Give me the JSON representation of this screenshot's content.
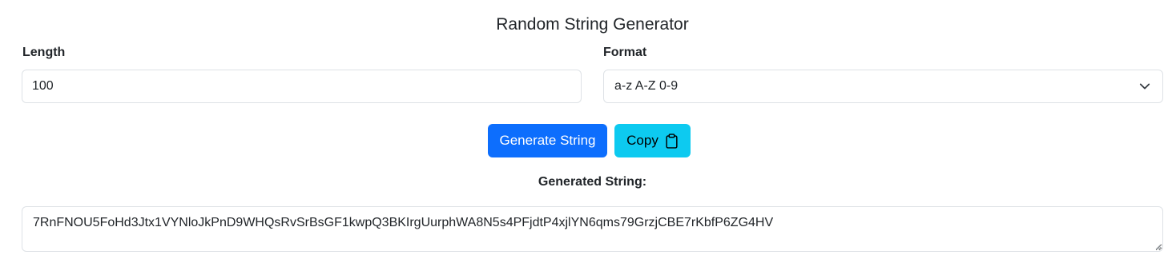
{
  "header": {
    "title": "Random String Generator"
  },
  "length_field": {
    "label": "Length",
    "value": "100"
  },
  "format_field": {
    "label": "Format",
    "selected": "a-z A-Z 0-9",
    "icon": "chevron-down-icon"
  },
  "actions": {
    "generate_label": "Generate String",
    "copy_label": "Copy",
    "copy_icon": "clipboard-icon"
  },
  "result": {
    "label": "Generated String:",
    "value": "7RnFNOU5FoHd3Jtx1VYNloJkPnD9WHQsRvSrBsGF1kwpQ3BKIrgUurphWA8N5s4PFjdtP4xjlYN6qms79GrzjCBE7rKbfP6ZG4HV"
  },
  "colors": {
    "primary": "#0d6efd",
    "info": "#0dcaf0",
    "border": "#dee2e6",
    "text": "#212529"
  }
}
